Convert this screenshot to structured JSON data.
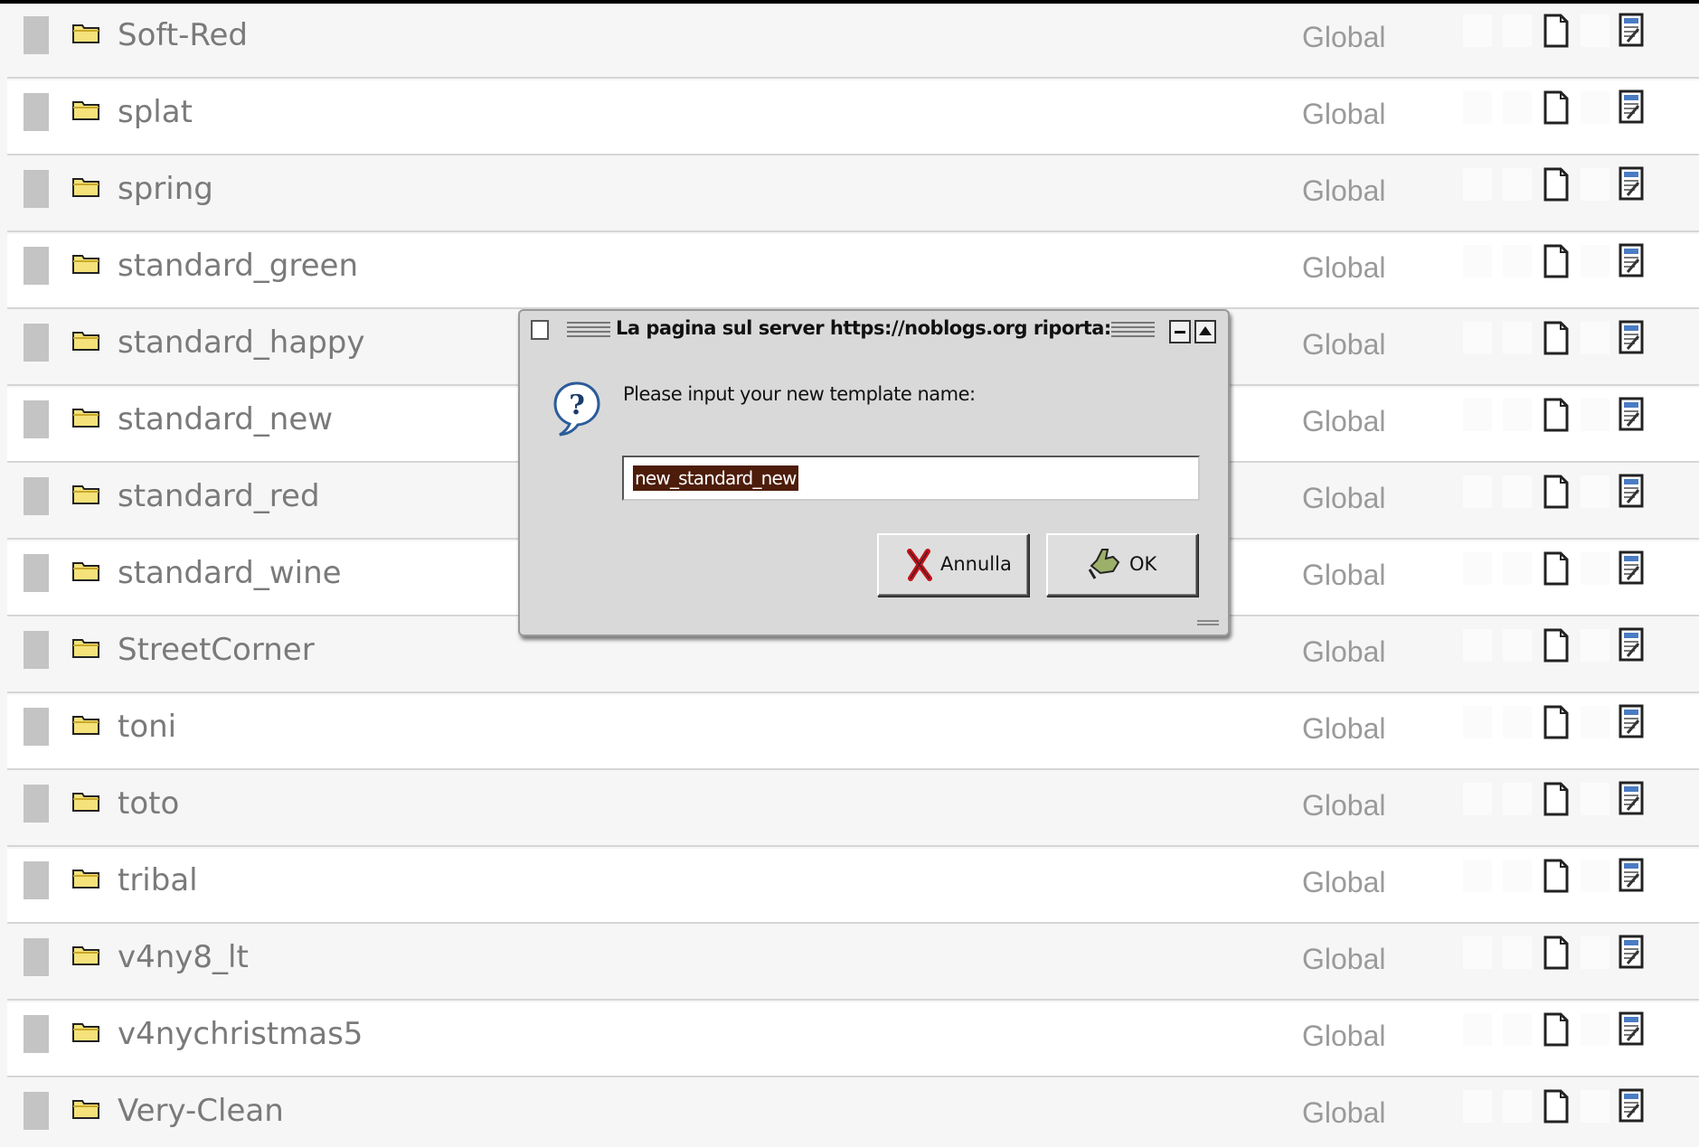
{
  "templates": [
    {
      "name": "Soft-Red",
      "scope": "Global"
    },
    {
      "name": "splat",
      "scope": "Global"
    },
    {
      "name": "spring",
      "scope": "Global"
    },
    {
      "name": "standard_green",
      "scope": "Global"
    },
    {
      "name": "standard_happy",
      "scope": "Global"
    },
    {
      "name": "standard_new",
      "scope": "Global"
    },
    {
      "name": "standard_red",
      "scope": "Global"
    },
    {
      "name": "standard_wine",
      "scope": "Global"
    },
    {
      "name": "StreetCorner",
      "scope": "Global"
    },
    {
      "name": "toni",
      "scope": "Global"
    },
    {
      "name": "toto",
      "scope": "Global"
    },
    {
      "name": "tribal",
      "scope": "Global"
    },
    {
      "name": "v4ny8_lt",
      "scope": "Global"
    },
    {
      "name": "v4nychristmas5",
      "scope": "Global"
    },
    {
      "name": "Very-Clean",
      "scope": "Global"
    }
  ],
  "icons": {
    "folder": "folder-icon",
    "copy": "copy-icon",
    "edit": "edit-icon",
    "question": "question-icon",
    "cancel": "x-icon",
    "ok": "thumbs-up-icon"
  },
  "dialog": {
    "title": "La pagina sul server https://noblogs.org riporta:",
    "message": "Please input your new template name:",
    "input_value": "new_standard_new",
    "cancel_label": "Annulla",
    "ok_label": "OK"
  },
  "colors": {
    "selection": "#4d1c0a",
    "folder": "#f5e27a",
    "row_odd": "#f6f6f6",
    "row_even": "#ffffff"
  }
}
